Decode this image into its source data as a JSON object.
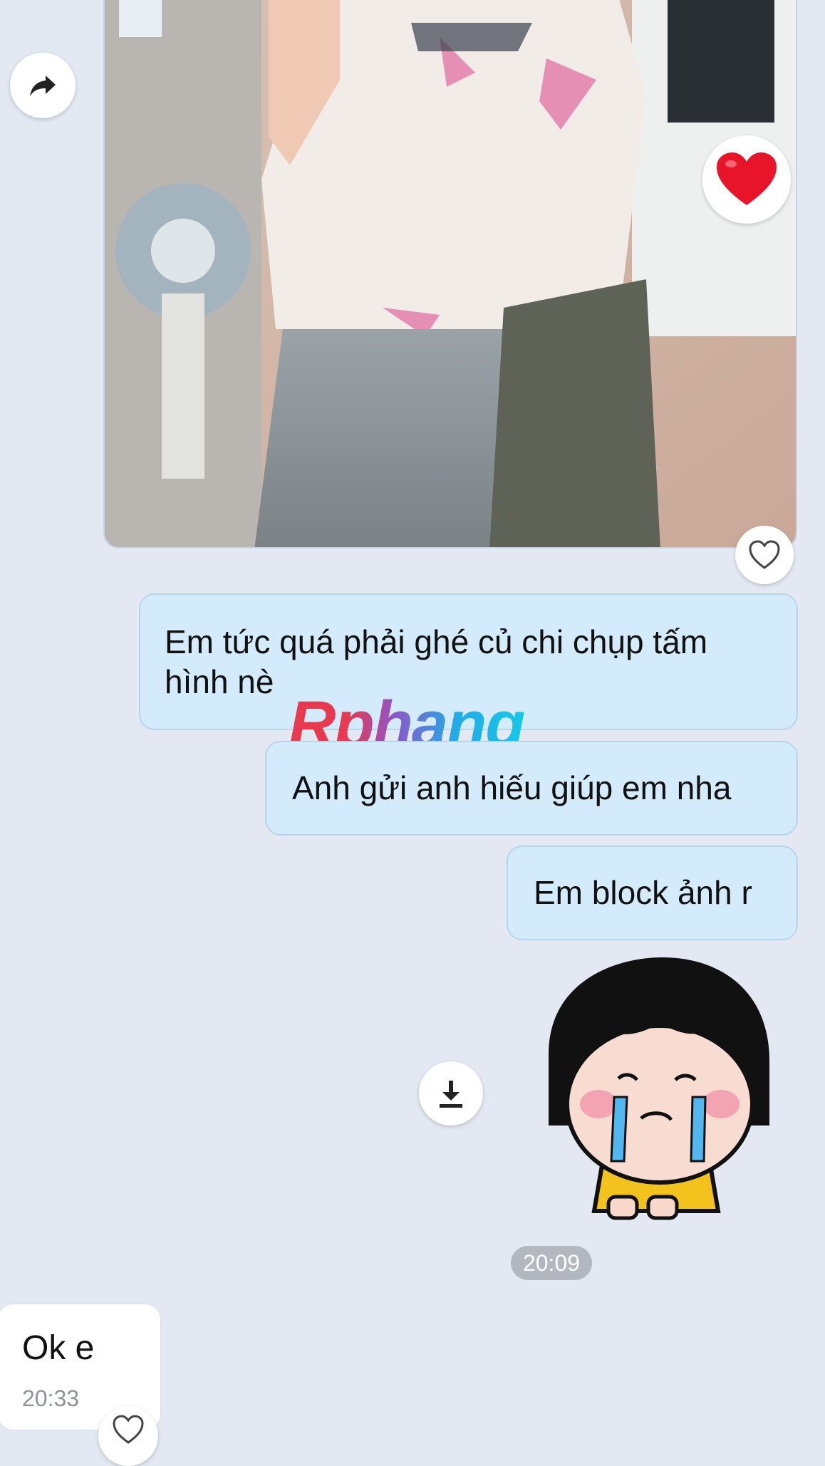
{
  "messages": {
    "outgoing_1": "Em tức quá phải ghé củ chi chụp tấm hình nè",
    "outgoing_2": "Anh gửi anh hiếu giúp em nha",
    "outgoing_3": "Em block ảnh r"
  },
  "time_separator": "20:09",
  "incoming": {
    "text": "Ok e",
    "time": "20:33"
  },
  "watermark": "Rphang",
  "icons": {
    "forward": "forward-arrow-icon",
    "reaction": "red-heart-icon",
    "like": "heart-outline-icon",
    "download": "download-icon"
  },
  "colors": {
    "background": "#e3e8f2",
    "outgoing_bubble": "#d4ebfb",
    "incoming_bubble": "#ffffff",
    "time_pill": "#b3b8c0"
  }
}
